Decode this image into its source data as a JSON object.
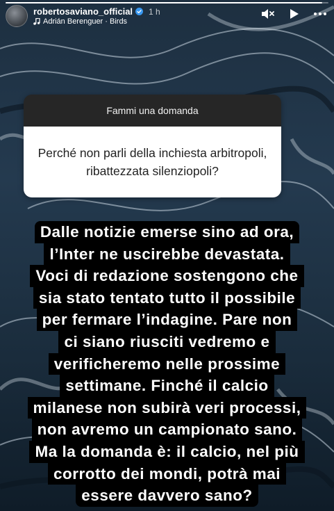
{
  "story": {
    "progress": 0.98,
    "username": "robertosaviano_official",
    "verified": true,
    "time_ago": "1 h",
    "music_label": "Adrián Berenguer · Birds",
    "icons": {
      "verified": "verified-badge-icon",
      "music": "music-note-icon",
      "mute": "speaker-muted-icon",
      "play": "play-icon",
      "more": "more-options-icon"
    }
  },
  "question_sticker": {
    "header": "Fammi una domanda",
    "question": "Perché non parli della inchiesta arbitropoli, ribattezzata silenziopoli?"
  },
  "answer": {
    "lines": [
      "Dalle notizie emerse sino ad ora,",
      "l’Inter ne uscirebbe devastata.",
      "Voci di redazione sostengono che",
      "sia stato tentato tutto il possibile",
      "per fermare l’indagine. Pare non",
      "ci siano riusciti vedremo e",
      "verificheremo nelle prossime",
      "settimane. Finché il calcio",
      "milanese non subirà veri processi,",
      "non avremo un campionato sano.",
      "Ma la domanda è: il calcio, nel più",
      "corrotto dei mondi, potrà mai",
      "essere davvero sano?"
    ]
  },
  "colors": {
    "sticker_header_bg": "#262626",
    "sticker_body_bg": "#ffffff",
    "answer_bg": "#000000",
    "answer_text": "#ffffff",
    "verified_blue": "#3897f0"
  }
}
